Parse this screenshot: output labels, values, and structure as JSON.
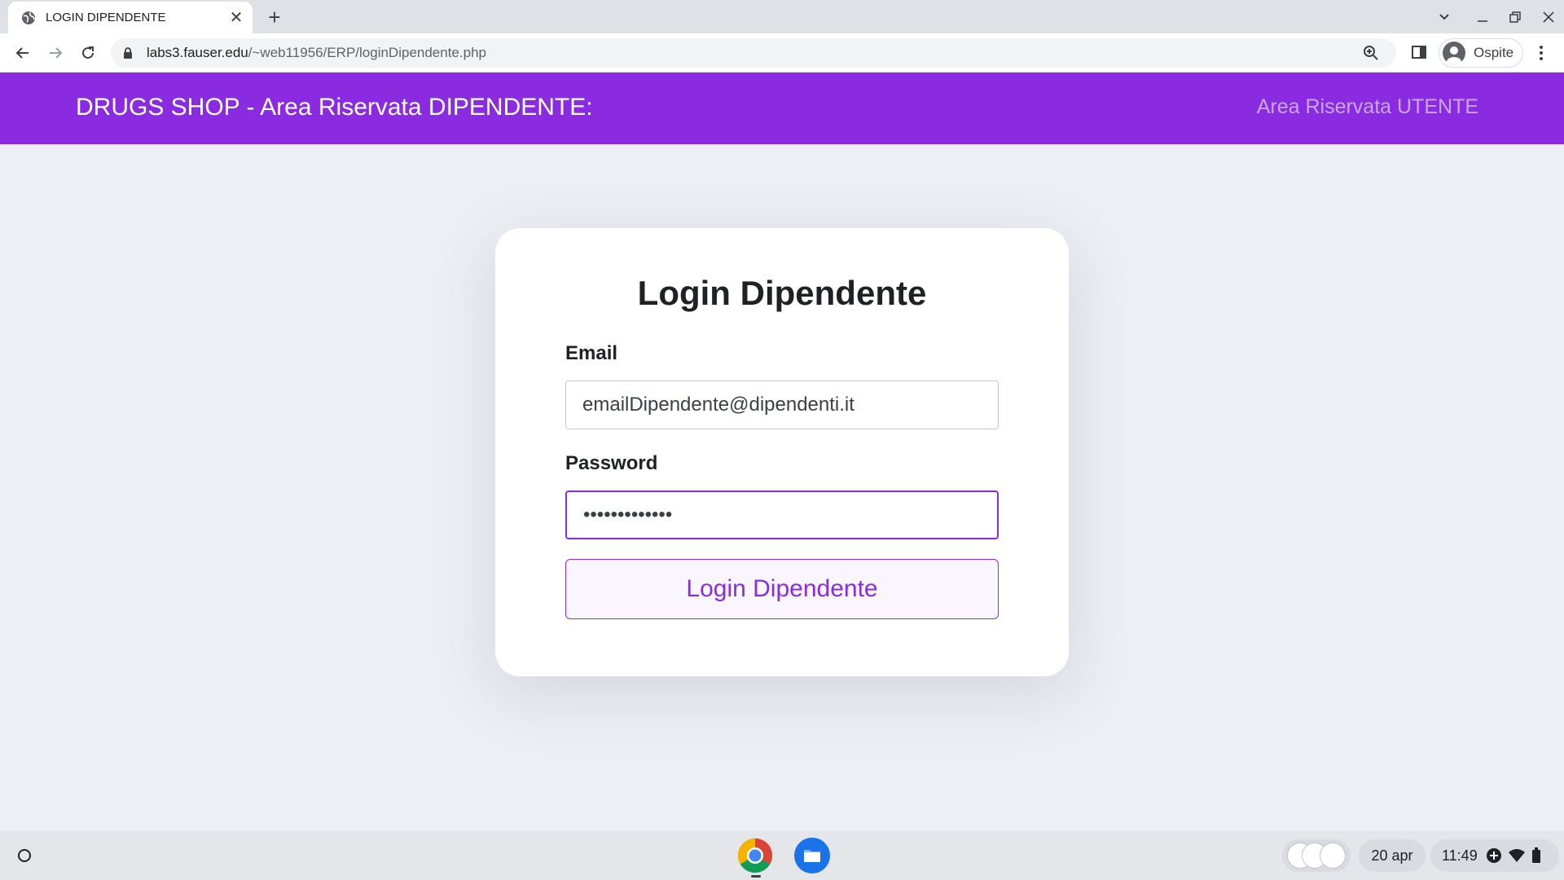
{
  "browser": {
    "tab_title": "LOGIN DIPENDENTE",
    "url_host": "labs3.fauser.edu",
    "url_path": "/~web11956/ERP/loginDipendente.php",
    "profile_name": "Ospite"
  },
  "header": {
    "title": "DRUGS SHOP - Area Riservata DIPENDENTE:",
    "user_link": "Area Riservata UTENTE",
    "background_color": "#8a2be2"
  },
  "form": {
    "title": "Login Dipendente",
    "email_label": "Email",
    "email_value": "emailDipendente@dipendenti.it",
    "password_label": "Password",
    "password_value": "•••••••••••••",
    "submit_label": "Login Dipendente"
  },
  "shelf": {
    "date": "20 apr",
    "time": "11:49"
  }
}
